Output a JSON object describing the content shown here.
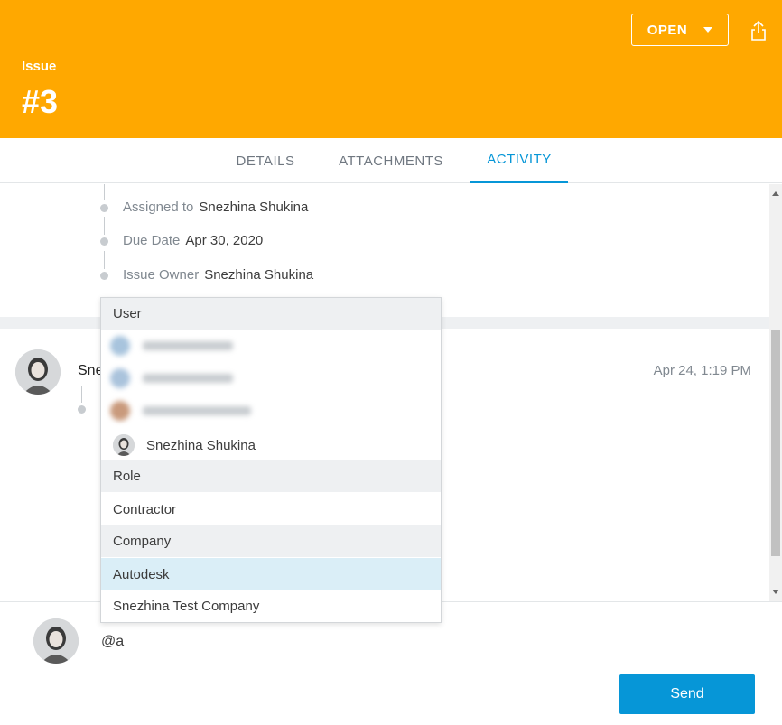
{
  "header": {
    "label": "Issue",
    "number": "#3",
    "status": "OPEN",
    "background": "#ffa800"
  },
  "tabs": [
    {
      "label": "DETAILS"
    },
    {
      "label": "ATTACHMENTS"
    },
    {
      "label": "ACTIVITY",
      "active": true
    }
  ],
  "activity": {
    "fields": [
      {
        "label": "Assigned to",
        "value": "Snezhina Shukina"
      },
      {
        "label": "Due Date",
        "value": "Apr 30, 2020"
      },
      {
        "label": "Issue Owner",
        "value": "Snezhina Shukina"
      }
    ],
    "comment": {
      "name_partial": "Sne",
      "time": "Apr 24, 1:19 PM"
    }
  },
  "mention_dropdown": {
    "user_header": "User",
    "user_visible": "Snezhina Shukina",
    "role_header": "Role",
    "role_item": "Contractor",
    "company_header": "Company",
    "company_items": [
      "Autodesk",
      "Snezhina Test Company"
    ]
  },
  "compose": {
    "value": "@a",
    "send_label": "Send"
  },
  "colors": {
    "accent": "#0696d7",
    "header": "#ffa800",
    "highlight": "#daeef7"
  }
}
